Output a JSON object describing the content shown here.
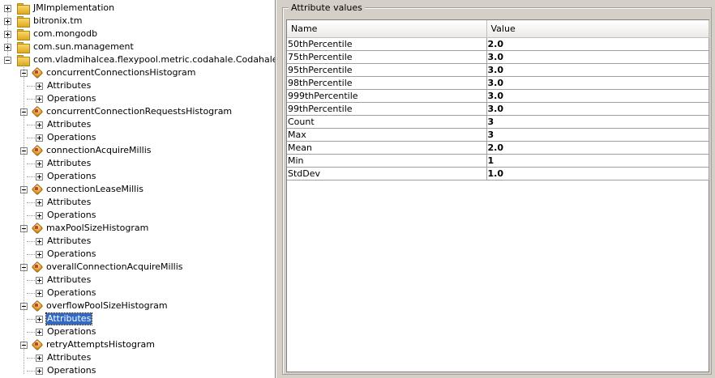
{
  "tree": {
    "top_level": [
      {
        "label": "JMImplementation",
        "expanded": false
      },
      {
        "label": "bitronix.tm",
        "expanded": false
      },
      {
        "label": "com.mongodb",
        "expanded": false
      },
      {
        "label": "com.sun.management",
        "expanded": false
      },
      {
        "label": "com.vladmihalcea.flexypool.metric.codahale.CodahaleMetrics.",
        "expanded": true
      }
    ],
    "beans": [
      {
        "label": "concurrentConnectionsHistogram"
      },
      {
        "label": "concurrentConnectionRequestsHistogram"
      },
      {
        "label": "connectionAcquireMillis"
      },
      {
        "label": "connectionLeaseMillis"
      },
      {
        "label": "maxPoolSizeHistogram"
      },
      {
        "label": "overallConnectionAcquireMillis"
      },
      {
        "label": "overflowPoolSizeHistogram"
      },
      {
        "label": "retryAttemptsHistogram"
      }
    ],
    "child_labels": {
      "attributes": "Attributes",
      "operations": "Operations"
    },
    "selected": {
      "bean_index": 6,
      "child": "attributes"
    }
  },
  "attribute_panel": {
    "title": "Attribute values",
    "columns": [
      "Name",
      "Value"
    ],
    "rows": [
      {
        "name": "50thPercentile",
        "value": "2.0"
      },
      {
        "name": "75thPercentile",
        "value": "3.0"
      },
      {
        "name": "95thPercentile",
        "value": "3.0"
      },
      {
        "name": "98thPercentile",
        "value": "3.0"
      },
      {
        "name": "999thPercentile",
        "value": "3.0"
      },
      {
        "name": "99thPercentile",
        "value": "3.0"
      },
      {
        "name": "Count",
        "value": "3"
      },
      {
        "name": "Max",
        "value": "3"
      },
      {
        "name": "Mean",
        "value": "2.0"
      },
      {
        "name": "Min",
        "value": "1"
      },
      {
        "name": "StdDev",
        "value": "1.0"
      }
    ]
  }
}
